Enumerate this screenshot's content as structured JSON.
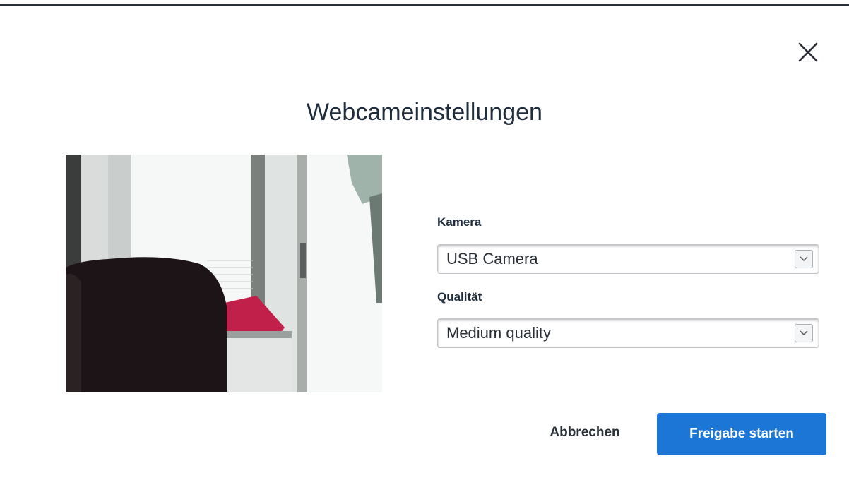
{
  "dialog": {
    "title": "Webcameinstellungen",
    "close_icon": "close-icon"
  },
  "camera": {
    "label": "Kamera",
    "selected": "USB Camera"
  },
  "quality": {
    "label": "Qualität",
    "selected": "Medium quality"
  },
  "actions": {
    "cancel_label": "Abbrechen",
    "start_label": "Freigabe starten"
  },
  "colors": {
    "primary": "#1b76d6",
    "text": "#1f2d3d"
  }
}
